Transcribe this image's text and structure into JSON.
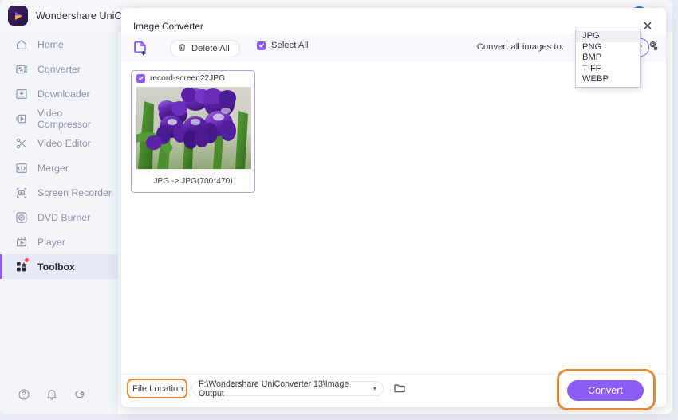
{
  "app": {
    "brand_name": "Wondershare UniCon",
    "logo_icon": "wondershare-play-logo"
  },
  "sidebar": {
    "items": [
      {
        "label": "Home",
        "icon": "home-icon",
        "active": false
      },
      {
        "label": "Converter",
        "icon": "converter-icon",
        "active": false
      },
      {
        "label": "Downloader",
        "icon": "download-icon",
        "active": false
      },
      {
        "label": "Video Compressor",
        "icon": "compressor-icon",
        "active": false
      },
      {
        "label": "Video Editor",
        "icon": "scissors-icon",
        "active": false
      },
      {
        "label": "Merger",
        "icon": "merger-icon",
        "active": false
      },
      {
        "label": "Screen Recorder",
        "icon": "screen-recorder-icon",
        "active": false
      },
      {
        "label": "DVD Burner",
        "icon": "dvd-burner-icon",
        "active": false
      },
      {
        "label": "Player",
        "icon": "player-icon",
        "active": false
      },
      {
        "label": "Toolbox",
        "icon": "toolbox-icon",
        "active": true,
        "badge": true
      }
    ],
    "bottom_icons": [
      "help-icon",
      "bell-icon",
      "gift-icon"
    ]
  },
  "dialog": {
    "title": "Image Converter",
    "close_label": "✕",
    "toolbar": {
      "add_file_icon": "add-file-icon",
      "delete_all_label": "Delete All",
      "delete_all_icon": "trash-icon",
      "select_all_label": "Select All",
      "select_all_checked": true,
      "convert_to_label": "Convert all images to:",
      "format_selected": "JPG",
      "format_chevron": "▾",
      "format_options": [
        "JPG",
        "PNG",
        "BMP",
        "TIFF",
        "WEBP"
      ],
      "format_menu_open": true,
      "gear_icon": "settings-gear-icon"
    },
    "files": [
      {
        "name": "record-screen22JPG",
        "checked": true,
        "conversion": "JPG -> JPG(700*470)",
        "thumbnail": "purple-iris-flowers"
      }
    ],
    "footer": {
      "file_location_label": "File Location:",
      "file_location_value": "F:\\Wondershare UniConverter 13\\Image Output",
      "file_location_chevron": "▾",
      "folder_icon": "folder-icon",
      "convert_label": "Convert"
    }
  },
  "colors": {
    "accent": "#8b5cf6",
    "highlight": "#e08b3a",
    "sidebar_bg": "#f3f5fb",
    "avatar": "#1a73e8",
    "badge": "#ff4d4f"
  }
}
